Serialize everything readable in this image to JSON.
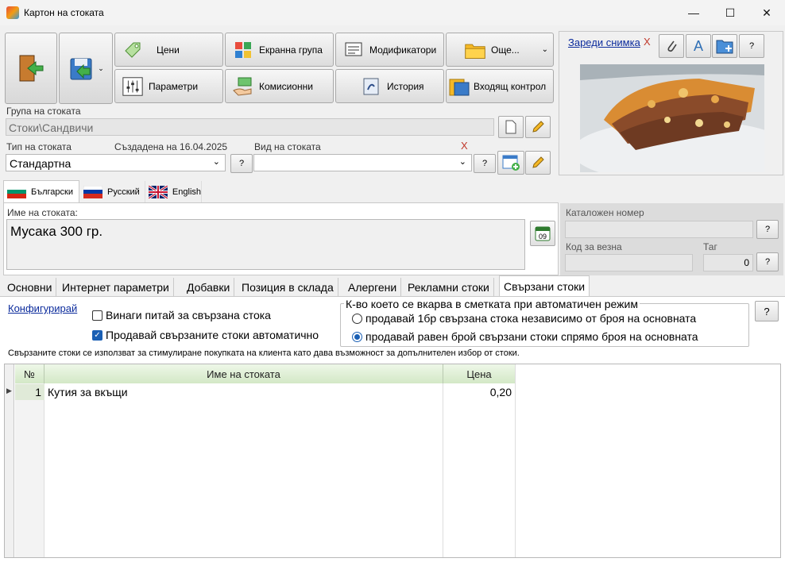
{
  "window": {
    "title": "Картон на стоката",
    "minimize": "—",
    "maximize": "☐",
    "close": "✕"
  },
  "toolbar": {
    "prices": "Цени",
    "screen_group": "Екранна група",
    "modifiers": "Модификатори",
    "more": "Още...",
    "parameters": "Параметри",
    "commissions": "Комисионни",
    "history": "История",
    "incoming_control": "Входящ контрол"
  },
  "image_panel": {
    "load_link": "Зареди снимка",
    "remove": "X",
    "help": "?"
  },
  "group": {
    "label": "Група на стоката",
    "value": "Стоки\\Сандвичи"
  },
  "type": {
    "label": "Тип на стоката",
    "value": "Стандартна",
    "created": "Създадена на 16.04.2025",
    "help": "?"
  },
  "kind": {
    "label": "Вид на стоката",
    "value": "",
    "remove": "X",
    "help": "?"
  },
  "languages": [
    "Български",
    "Русский",
    "English"
  ],
  "name": {
    "label": "Име на стоката:",
    "value": "Мусака 300 гр."
  },
  "calendar_day": "09",
  "catalog": {
    "label": "Каталожен номер",
    "value": "",
    "help": "?"
  },
  "scale_code": {
    "label": "Код за везна",
    "value": ""
  },
  "tag": {
    "label": "Таг",
    "value": "0",
    "help": "?"
  },
  "tabs": [
    "Основни",
    "Интернет параметри",
    "Добавки",
    "Позиция в склада",
    "Алергени",
    "Рекламни стоки",
    "Свързани стоки"
  ],
  "related": {
    "configure": "Конфигурирай",
    "always_ask": "Винаги питай за свързана стока",
    "always_ask_checked": false,
    "sell_auto": "Продавай свързаните стоки автоматично",
    "sell_auto_checked": true,
    "group_title": "К-во което се вкарва в сметката при автоматичен режим",
    "radio1": "продавай 1бр свързана стока независимо от броя на основната",
    "radio2": "продавай равен брой свързани стоки спрямо броя на основната",
    "selected_radio": 2,
    "help": "?",
    "info": "Свързаните стоки се използват за стимулиране покупката на клиента като дава възможност за допълнителен избор от стоки."
  },
  "grid": {
    "columns": [
      "№",
      "Име на стоката",
      "Цена"
    ],
    "rows": [
      {
        "no": "1",
        "name": "Кутия за вкъщи",
        "price": "0,20"
      }
    ]
  },
  "colors": {
    "accent_link": "#0b2b9c",
    "remove_red": "#c0392b",
    "grid_header": "#d3e8c6"
  }
}
